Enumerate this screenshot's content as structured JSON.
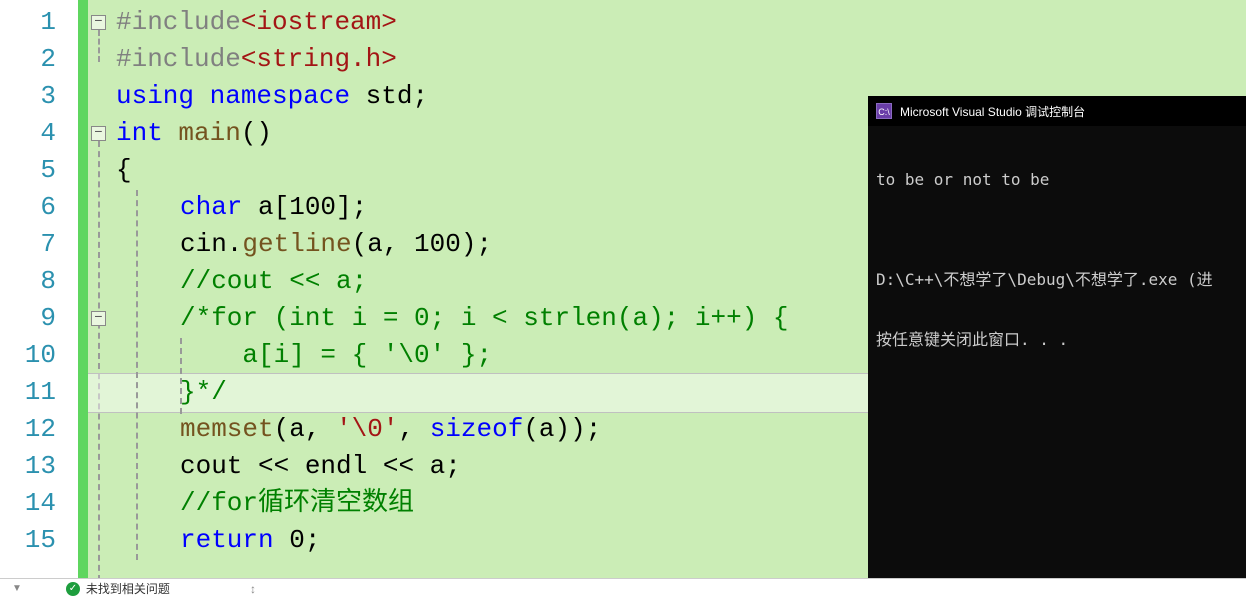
{
  "editor": {
    "line_numbers": [
      "1",
      "2",
      "3",
      "4",
      "5",
      "6",
      "7",
      "8",
      "9",
      "10",
      "11",
      "12",
      "13",
      "14",
      "15"
    ],
    "lines": {
      "l1": {
        "pp": "#include",
        "inc": "<iostream>"
      },
      "l2": {
        "pp": "#include",
        "inc": "<string.h>"
      },
      "l3": {
        "kw1": "using",
        "kw2": "namespace",
        "id": " std;"
      },
      "l4": {
        "type": "int",
        "func": " main",
        "paren": "()"
      },
      "l5": {
        "brace": "{"
      },
      "l6": {
        "type": "char",
        "rest": " a[100];"
      },
      "l7": {
        "pre": "cin.",
        "func": "getline",
        "rest": "(a, 100);"
      },
      "l8": {
        "cmt": "//cout << a;"
      },
      "l9": {
        "cmt": "/*for (int i = 0; i < strlen(a); i++) {"
      },
      "l10": {
        "cmt": "    a[i] = { '\\0' };"
      },
      "l11": {
        "cmt": "}*/"
      },
      "l12": {
        "func1": "memset",
        "p1": "(a, ",
        "str": "'\\0'",
        "p2": ", ",
        "kw": "sizeof",
        "p3": "(a));"
      },
      "l13": {
        "pre": "cout << ",
        "id": "endl",
        "rest": " << a;"
      },
      "l14": {
        "cmt": "//for循环清空数组"
      },
      "l15": {
        "kw": "return",
        "rest": " 0;"
      }
    }
  },
  "console": {
    "title": "Microsoft Visual Studio 调试控制台",
    "icon_text": "C:\\",
    "output_line1": "to be or not to be",
    "output_blank": "",
    "output_line2": "D:\\C++\\不想学了\\Debug\\不想学了.exe (进",
    "output_line3": "按任意键关闭此窗口. . ."
  },
  "status": {
    "ok_glyph": "✓",
    "message": "未找到相关问题",
    "chevron": "▼"
  }
}
